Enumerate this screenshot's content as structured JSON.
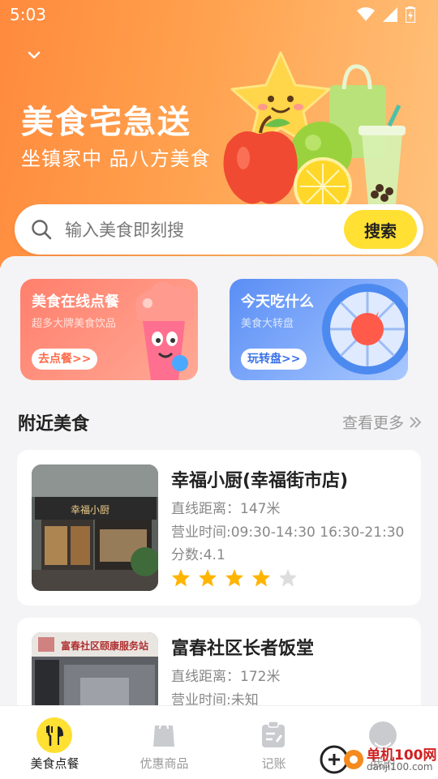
{
  "status_bar": {
    "time": "5:03"
  },
  "hero": {
    "title": "美食宅急送",
    "subtitle": "坐镇家中 品八方美食"
  },
  "search": {
    "placeholder": "输入美食即刻搜",
    "button": "搜索"
  },
  "promos": [
    {
      "title": "美食在线点餐",
      "subtitle": "超多大牌美食饮品",
      "button": "去点餐>>"
    },
    {
      "title": "今天吃什么",
      "subtitle": "美食大转盘",
      "button": "玩转盘>>"
    }
  ],
  "nearby": {
    "title": "附近美食",
    "more": "查看更多",
    "items": [
      {
        "name": "幸福小厨(幸福街市店)",
        "distance": "直线距离：147米",
        "hours": "营业时间:09:30-14:30 16:30-21:30",
        "score": "分数:4.1",
        "rating": 4,
        "sign_text": "幸福小厨"
      },
      {
        "name": "富春社区长者饭堂",
        "distance": "直线距离：172米",
        "hours": "营业时间:未知",
        "sign_text": "富春社区颐康服务站"
      }
    ]
  },
  "tabs": [
    {
      "label": "美食点餐",
      "icon": "utensils-icon",
      "active": true
    },
    {
      "label": "优惠商品",
      "icon": "shopping-bag-icon",
      "active": false
    },
    {
      "label": "记账",
      "icon": "clipboard-icon",
      "active": false
    },
    {
      "label": "我的",
      "icon": "profile-icon",
      "active": false
    }
  ],
  "watermark": {
    "text": "单机100网",
    "url": "danji100.com"
  },
  "colors": {
    "accent_yellow": "#ffe033",
    "hero_orange": "#ff8a3d",
    "star": "#ffb400",
    "star_empty": "#dddddd"
  }
}
